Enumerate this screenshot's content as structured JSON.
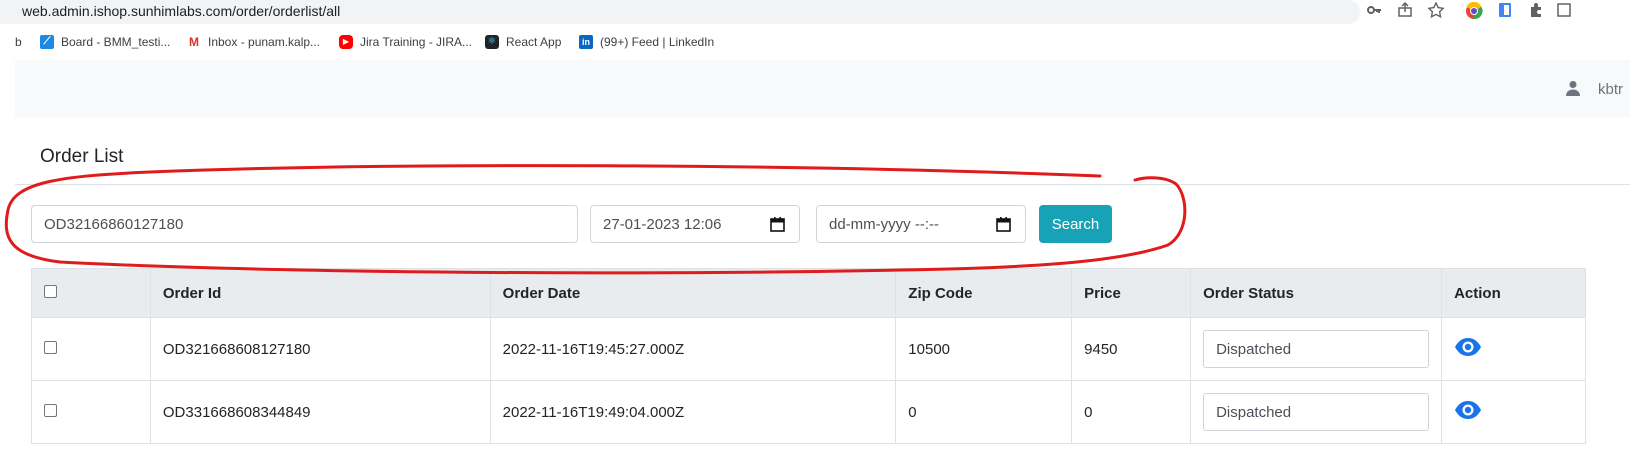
{
  "browser": {
    "url": "web.admin.ishop.sunhimlabs.com/order/orderlist/all",
    "bookmarks": [
      {
        "label": "b",
        "icon": ""
      },
      {
        "label": "Board - BMM_testi...",
        "icon": "feather-icon"
      },
      {
        "label": "Inbox - punam.kalp...",
        "icon": "gmail-icon"
      },
      {
        "label": "Jira Training - JIRA...",
        "icon": "youtube-icon"
      },
      {
        "label": "React App",
        "icon": "react-icon"
      },
      {
        "label": "(99+) Feed | LinkedIn",
        "icon": "linkedin-icon"
      }
    ]
  },
  "header": {
    "user_name": "kbtr"
  },
  "page": {
    "title": "Order List"
  },
  "filters": {
    "order_id_value": "OD32166860127180",
    "start_date_value": "27-01-2023 12:06",
    "end_date_placeholder": "dd-mm-yyyy --:--",
    "search_label": "Search"
  },
  "table": {
    "headers": [
      "",
      "Order Id",
      "Order Date",
      "Zip Code",
      "Price",
      "Order Status",
      "Action"
    ],
    "rows": [
      {
        "order_id": "OD321668608127180",
        "order_date": "2022-11-16T19:45:27.000Z",
        "zip": "10500",
        "price": "9450",
        "status": "Dispatched"
      },
      {
        "order_id": "OD331668608344849",
        "order_date": "2022-11-16T19:49:04.000Z",
        "zip": "0",
        "price": "0",
        "status": "Dispatched"
      }
    ]
  },
  "colors": {
    "accent": "#17a2b8",
    "eye_icon": "#1a73e8",
    "annotation": "#e01b1b"
  }
}
